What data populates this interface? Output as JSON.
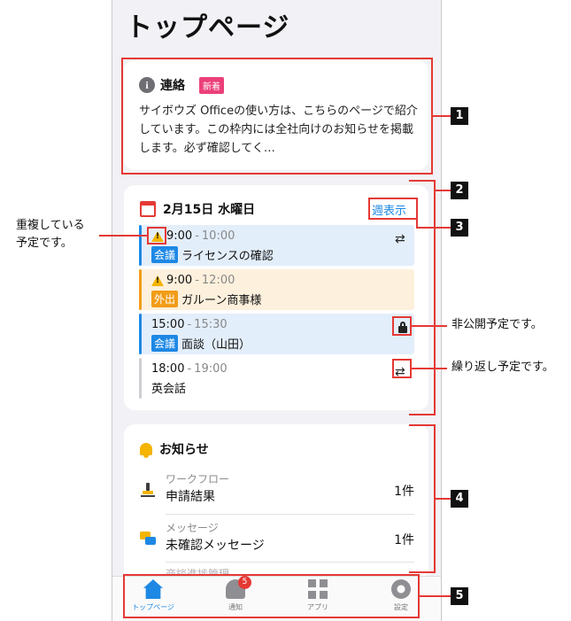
{
  "page_title": "トップページ",
  "notice": {
    "title": "連絡",
    "badge": "新着",
    "body": "サイボウズ Officeの使い方は、こちらのページで紹介しています。この枠内には全社向けのお知らせを掲載します。必ず確認してく…"
  },
  "schedule": {
    "date": "2月15日 水曜日",
    "week_link": "週表示",
    "events": [
      {
        "start": "9:00",
        "end": "10:00",
        "category": "会議",
        "title": "ライセンスの確認",
        "color": "#1e88e5",
        "bg": "#e3eefb"
      },
      {
        "start": "9:00",
        "end": "12:00",
        "category": "外出",
        "title": "ガルーン商事様",
        "color": "#f29d18",
        "bg": "#fdf0dc"
      },
      {
        "start": "15:00",
        "end": "15:30",
        "category": "会議",
        "title": "面談（山田）",
        "color": "#1e88e5",
        "bg": "#e3eefb"
      },
      {
        "start": "18:00",
        "end": "19:00",
        "category": "",
        "title": "英会話",
        "color": "#cfcfd3",
        "bg": "#ffffff"
      }
    ],
    "dash": "-"
  },
  "news": {
    "title": "お知らせ",
    "items": [
      {
        "category": "ワークフロー",
        "label": "申請結果",
        "count": "1件"
      },
      {
        "category": "メッセージ",
        "label": "未確認メッセージ",
        "count": "1件"
      }
    ],
    "partial_item": "商談進捗管理"
  },
  "tabs": [
    {
      "label": "トップページ",
      "active": true
    },
    {
      "label": "通知",
      "badge": "5"
    },
    {
      "label": "アプリ"
    },
    {
      "label": "設定"
    }
  ],
  "annotations": {
    "numbers": [
      "1",
      "2",
      "3",
      "4",
      "5"
    ],
    "callout_duplicate": [
      "重複している",
      "予定です。"
    ],
    "callout_private": "非公開予定です。",
    "callout_repeat": "繰り返し予定です。"
  },
  "colors": {
    "accent": "#1e88e5",
    "annotation": "#e53935",
    "badge_new": "#ec407a"
  }
}
